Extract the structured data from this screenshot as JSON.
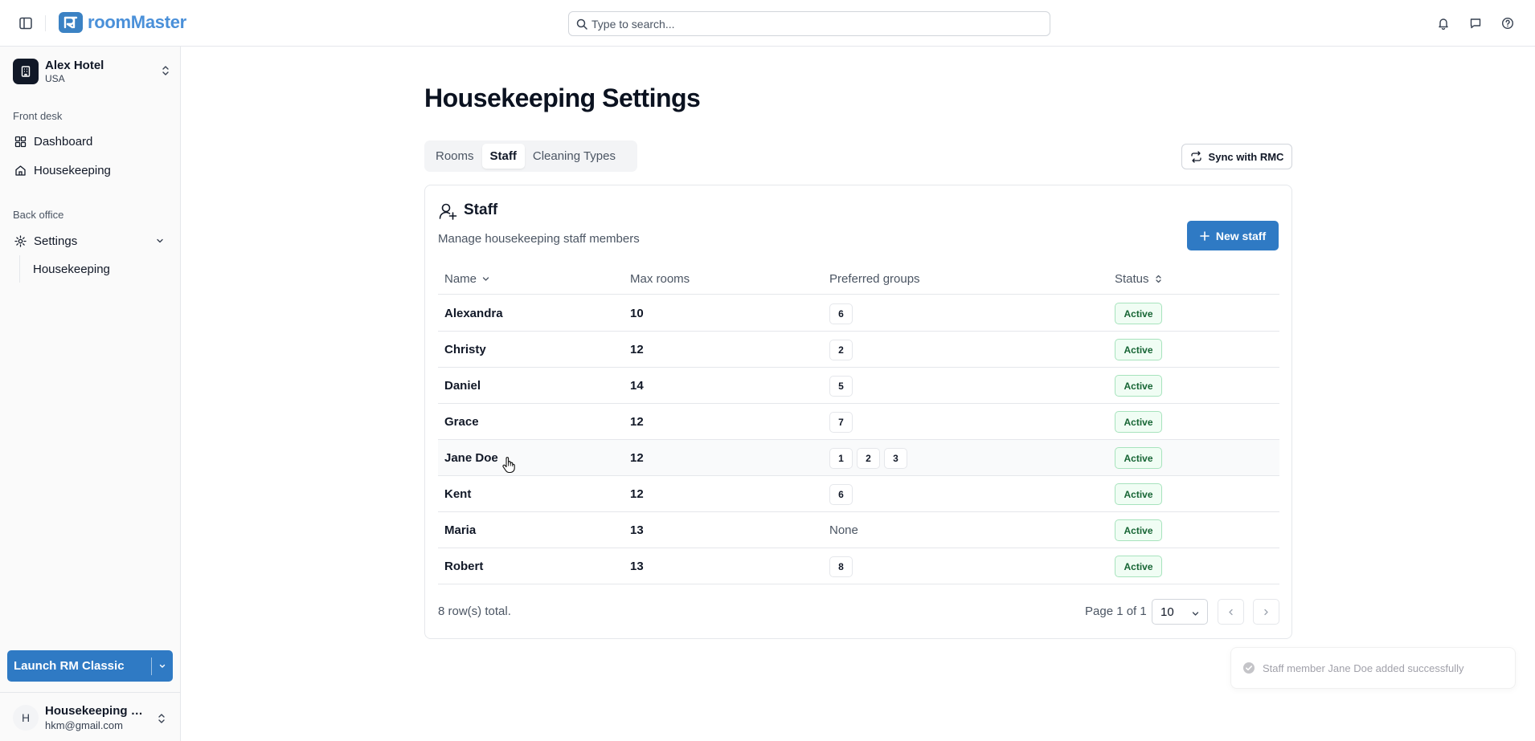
{
  "topbar": {
    "logo_text": "roomMaster",
    "search_placeholder": "Type to search...",
    "icons": [
      "sidebar-toggle-icon",
      "bell-icon",
      "message-icon",
      "help-icon"
    ]
  },
  "sidebar": {
    "hotel": {
      "name": "Alex Hotel",
      "country": "USA"
    },
    "front_desk_label": "Front desk",
    "front_desk_items": [
      {
        "label": "Dashboard",
        "icon": "dashboard-icon"
      },
      {
        "label": "Housekeeping",
        "icon": "home-icon"
      }
    ],
    "back_office_label": "Back office",
    "settings_label": "Settings",
    "settings_sub_item": "Housekeeping",
    "launch_label": "Launch RM Classic",
    "user": {
      "initial": "H",
      "name": "Housekeeping Manager",
      "email": "hkm@gmail.com"
    }
  },
  "main": {
    "title": "Housekeeping Settings",
    "tabs": [
      {
        "label": "Rooms",
        "active": false
      },
      {
        "label": "Staff",
        "active": true
      },
      {
        "label": "Cleaning Types",
        "active": false
      }
    ],
    "sync_label": "Sync with RMC",
    "card": {
      "title": "Staff",
      "description": "Manage housekeeping staff members",
      "new_button": "New staff",
      "columns": {
        "name": "Name",
        "max_rooms": "Max rooms",
        "preferred_groups": "Preferred groups",
        "status": "Status"
      },
      "rows": [
        {
          "name": "Alexandra",
          "max_rooms": "10",
          "groups": [
            "6"
          ],
          "status": "Active"
        },
        {
          "name": "Christy",
          "max_rooms": "12",
          "groups": [
            "2"
          ],
          "status": "Active"
        },
        {
          "name": "Daniel",
          "max_rooms": "14",
          "groups": [
            "5"
          ],
          "status": "Active"
        },
        {
          "name": "Grace",
          "max_rooms": "12",
          "groups": [
            "7"
          ],
          "status": "Active"
        },
        {
          "name": "Jane Doe",
          "max_rooms": "12",
          "groups": [
            "1",
            "2",
            "3"
          ],
          "status": "Active",
          "hovered": true
        },
        {
          "name": "Kent",
          "max_rooms": "12",
          "groups": [
            "6"
          ],
          "status": "Active"
        },
        {
          "name": "Maria",
          "max_rooms": "13",
          "groups": [],
          "groups_empty_text": "None",
          "status": "Active"
        },
        {
          "name": "Robert",
          "max_rooms": "13",
          "groups": [
            "8"
          ],
          "status": "Active"
        }
      ],
      "rows_total": "8 row(s) total.",
      "page_info": "Page 1 of 1",
      "page_size": "10"
    }
  },
  "toast": {
    "message": "Staff member Jane Doe added successfully"
  },
  "colors": {
    "primary": "#2f7ac4",
    "logo": "#4a90d9",
    "status_active_bg": "#f0fdf4",
    "status_active_text": "#166534",
    "status_active_border": "#a7e3bd"
  }
}
